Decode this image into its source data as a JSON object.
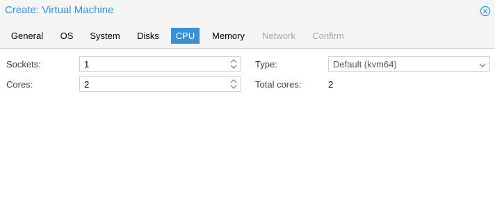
{
  "window": {
    "title": "Create: Virtual Machine",
    "close_icon": "close-icon"
  },
  "tabs": [
    {
      "label": "General",
      "state": "normal"
    },
    {
      "label": "OS",
      "state": "normal"
    },
    {
      "label": "System",
      "state": "normal"
    },
    {
      "label": "Disks",
      "state": "normal"
    },
    {
      "label": "CPU",
      "state": "active"
    },
    {
      "label": "Memory",
      "state": "normal"
    },
    {
      "label": "Network",
      "state": "disabled"
    },
    {
      "label": "Confirm",
      "state": "disabled"
    }
  ],
  "form": {
    "sockets": {
      "label": "Sockets:",
      "value": "1"
    },
    "cores": {
      "label": "Cores:",
      "value": "2"
    },
    "type": {
      "label": "Type:",
      "value": "Default (kvm64)"
    },
    "total_cores": {
      "label": "Total cores:",
      "value": "2"
    }
  },
  "colors": {
    "accent": "#3892d4",
    "disabled_text": "#a6a6a6",
    "header_bg": "#f5f5f5"
  }
}
